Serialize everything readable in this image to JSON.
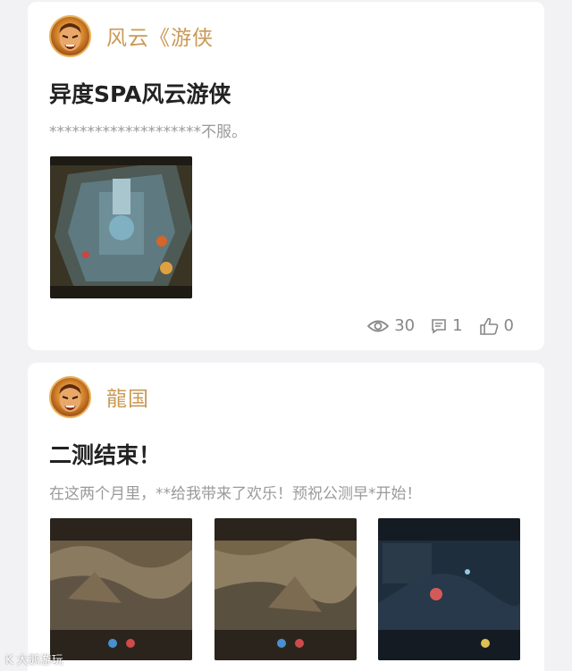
{
  "posts": [
    {
      "author": "风云《游侠",
      "title": "异度SPA风云游侠",
      "excerpt": "********************不服。",
      "stats": {
        "views": "30",
        "comments": "1",
        "likes": "0"
      }
    },
    {
      "author": "龍国",
      "title": "二测结束！",
      "excerpt": "在这两个月里，**给我带来了欢乐！预祝公测早*开始！"
    }
  ],
  "watermark": "K 大鹅游玩",
  "colors": {
    "author": "#c99a55",
    "stat": "#888888",
    "background": "#f2f2f4"
  }
}
